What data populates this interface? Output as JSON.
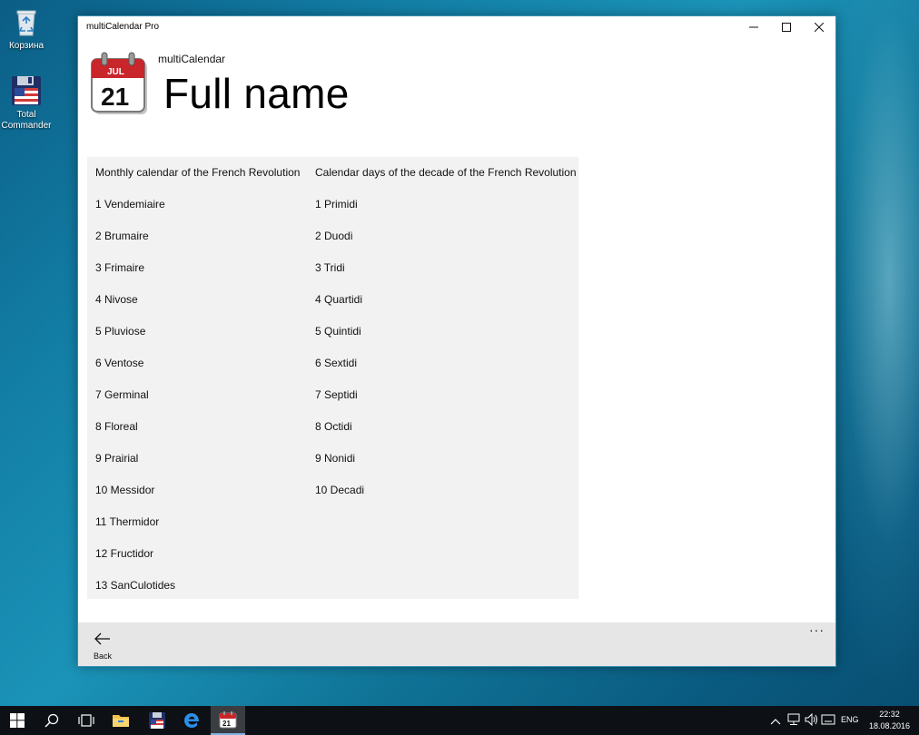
{
  "desktop": {
    "icons": [
      {
        "label": "Корзина",
        "icon": "recycle-bin-icon"
      },
      {
        "label": "Total Commander",
        "icon": "floppy-disk-icon"
      }
    ]
  },
  "window": {
    "title": "multiCalendar Pro",
    "controls": {
      "minimize": "—",
      "maximize": "☐",
      "close": "✕"
    }
  },
  "app": {
    "name": "multiCalendar",
    "page_title": "Full name",
    "icon": {
      "month": "JUL",
      "day": "21"
    }
  },
  "table": {
    "headers": [
      "Monthly calendar of the French Revolution",
      "Calendar days of the decade of the French Revolution"
    ],
    "months": [
      "1  Vendemiaire",
      "2  Brumaire",
      "3  Frimaire",
      "4  Nivose",
      "5  Pluviose",
      "6  Ventose",
      "7  Germinal",
      "8  Floreal",
      "9  Prairial",
      "10  Messidor",
      "11  Thermidor",
      "12  Fructidor",
      "13  SanCulotides"
    ],
    "days": [
      "1  Primidi",
      "2  Duodi",
      "3  Tridi",
      "4  Quartidi",
      "5  Quintidi",
      "6  Sextidi",
      "7  Septidi",
      "8  Octidi",
      "9  Nonidi",
      "10  Decadi"
    ]
  },
  "bottom_bar": {
    "back_label": "Back",
    "more_label": "···"
  },
  "taskbar": {
    "language": "ENG",
    "time": "22:32",
    "date": "18.08.2016",
    "calendar_day": "21"
  },
  "colors": {
    "window_bg": "#ffffff",
    "panel_bg": "#f2f2f2",
    "bottom_bar_bg": "#e6e6e6",
    "taskbar_bg": "#0d1015",
    "calendar_red": "#c8262a"
  }
}
